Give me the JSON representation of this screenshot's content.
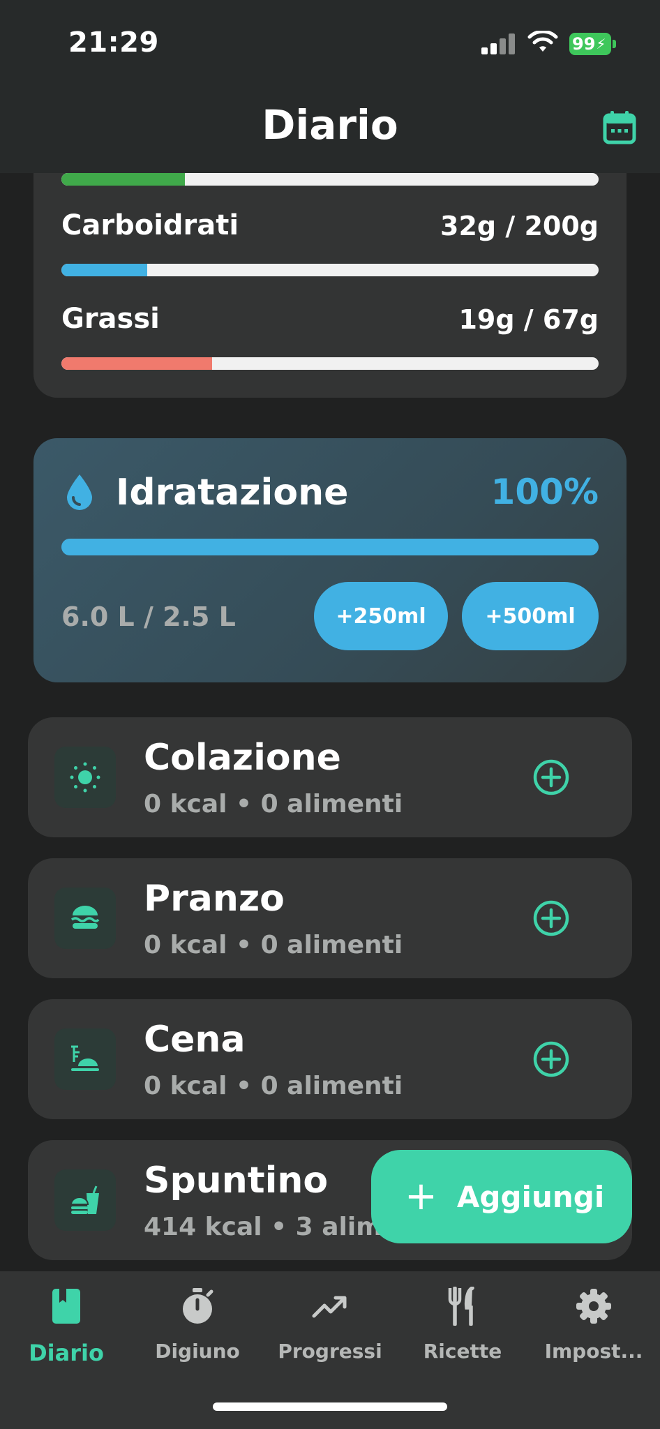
{
  "status_bar": {
    "time": "21:29",
    "battery": "99"
  },
  "header": {
    "title": "Diario",
    "calendar_icon": "calendar-icon"
  },
  "macros": [
    {
      "name": "",
      "value": "",
      "fraction": 0.23,
      "color": "#40a94a"
    },
    {
      "name": "Carboidrati",
      "value": "32g / 200g",
      "fraction": 0.16,
      "color": "#41b1e3"
    },
    {
      "name": "Grassi",
      "value": "19g / 67g",
      "fraction": 0.28,
      "color": "#f07a6d"
    }
  ],
  "hydration": {
    "title": "Idratazione",
    "percent": "100%",
    "fraction": 1.0,
    "amount": "6.0 L / 2.5 L",
    "buttons": [
      "+250ml",
      "+500ml"
    ],
    "accent": "#41b1e3"
  },
  "meals": [
    {
      "name": "Colazione",
      "summary": "0 kcal • 0 alimenti",
      "icon": "sun-icon"
    },
    {
      "name": "Pranzo",
      "summary": "0 kcal • 0 alimenti",
      "icon": "burger-icon"
    },
    {
      "name": "Cena",
      "summary": "0 kcal • 0 alimenti",
      "icon": "dinner-icon"
    },
    {
      "name": "Spuntino",
      "summary": "414 kcal • 3 alimenti",
      "icon": "snack-icon"
    }
  ],
  "fab": {
    "label": "Aggiungi",
    "color": "#3fd3a9"
  },
  "tabs": [
    {
      "label": "Diario",
      "icon": "book-icon",
      "active": true
    },
    {
      "label": "Digiuno",
      "icon": "stopwatch-icon",
      "active": false
    },
    {
      "label": "Progressi",
      "icon": "trending-up-icon",
      "active": false
    },
    {
      "label": "Ricette",
      "icon": "utensils-icon",
      "active": false
    },
    {
      "label": "Impost...",
      "icon": "gear-icon",
      "active": false
    }
  ]
}
